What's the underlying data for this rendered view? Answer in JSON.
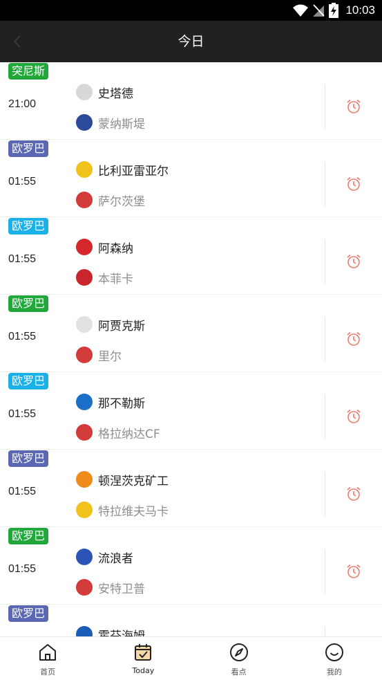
{
  "status_bar": {
    "time": "10:03"
  },
  "header": {
    "title": "今日"
  },
  "colors": {
    "green": "#21a83a",
    "purple": "#5b67b0",
    "blue": "#1ab0e8",
    "alarm": "#ef7a6a"
  },
  "matches": [
    {
      "league": "突尼斯",
      "league_color": "#21a83a",
      "time": "21:00",
      "home": "史塔德",
      "away": "蒙纳斯堤",
      "home_logo": "#d8d8d8",
      "away_logo": "#2c4a9a"
    },
    {
      "league": "欧罗巴",
      "league_color": "#5b67b0",
      "time": "01:55",
      "home": "比利亚雷亚尔",
      "away": "萨尔茨堡",
      "home_logo": "#f2c21c",
      "away_logo": "#d33a3a"
    },
    {
      "league": "欧罗巴",
      "league_color": "#1ab0e8",
      "time": "01:55",
      "home": "阿森纳",
      "away": "本菲卡",
      "home_logo": "#d4282d",
      "away_logo": "#c8262c"
    },
    {
      "league": "欧罗巴",
      "league_color": "#21a83a",
      "time": "01:55",
      "home": "阿贾克斯",
      "away": "里尔",
      "home_logo": "#e1e1e1",
      "away_logo": "#d33a3a"
    },
    {
      "league": "欧罗巴",
      "league_color": "#1ab0e8",
      "time": "01:55",
      "home": "那不勒斯",
      "away": "格拉纳达CF",
      "home_logo": "#1b6fc8",
      "away_logo": "#d33a3a"
    },
    {
      "league": "欧罗巴",
      "league_color": "#5b67b0",
      "time": "01:55",
      "home": "顿涅茨克矿工",
      "away": "特拉维夫马卡",
      "home_logo": "#f08a1c",
      "away_logo": "#f2c21c"
    },
    {
      "league": "欧罗巴",
      "league_color": "#21a83a",
      "time": "01:55",
      "home": "流浪者",
      "away": "安特卫普",
      "home_logo": "#2c54b8",
      "away_logo": "#d33a3a"
    },
    {
      "league": "欧罗巴",
      "league_color": "#5b67b0",
      "time": "",
      "home": "霍芬海姆",
      "away": "",
      "home_logo": "#1b5cb8",
      "away_logo": "#cccccc"
    }
  ],
  "tabs": [
    {
      "label": "首页",
      "icon": "home-icon"
    },
    {
      "label": "Today",
      "icon": "calendar-icon"
    },
    {
      "label": "看点",
      "icon": "compass-icon"
    },
    {
      "label": "我的",
      "icon": "smile-icon"
    }
  ]
}
